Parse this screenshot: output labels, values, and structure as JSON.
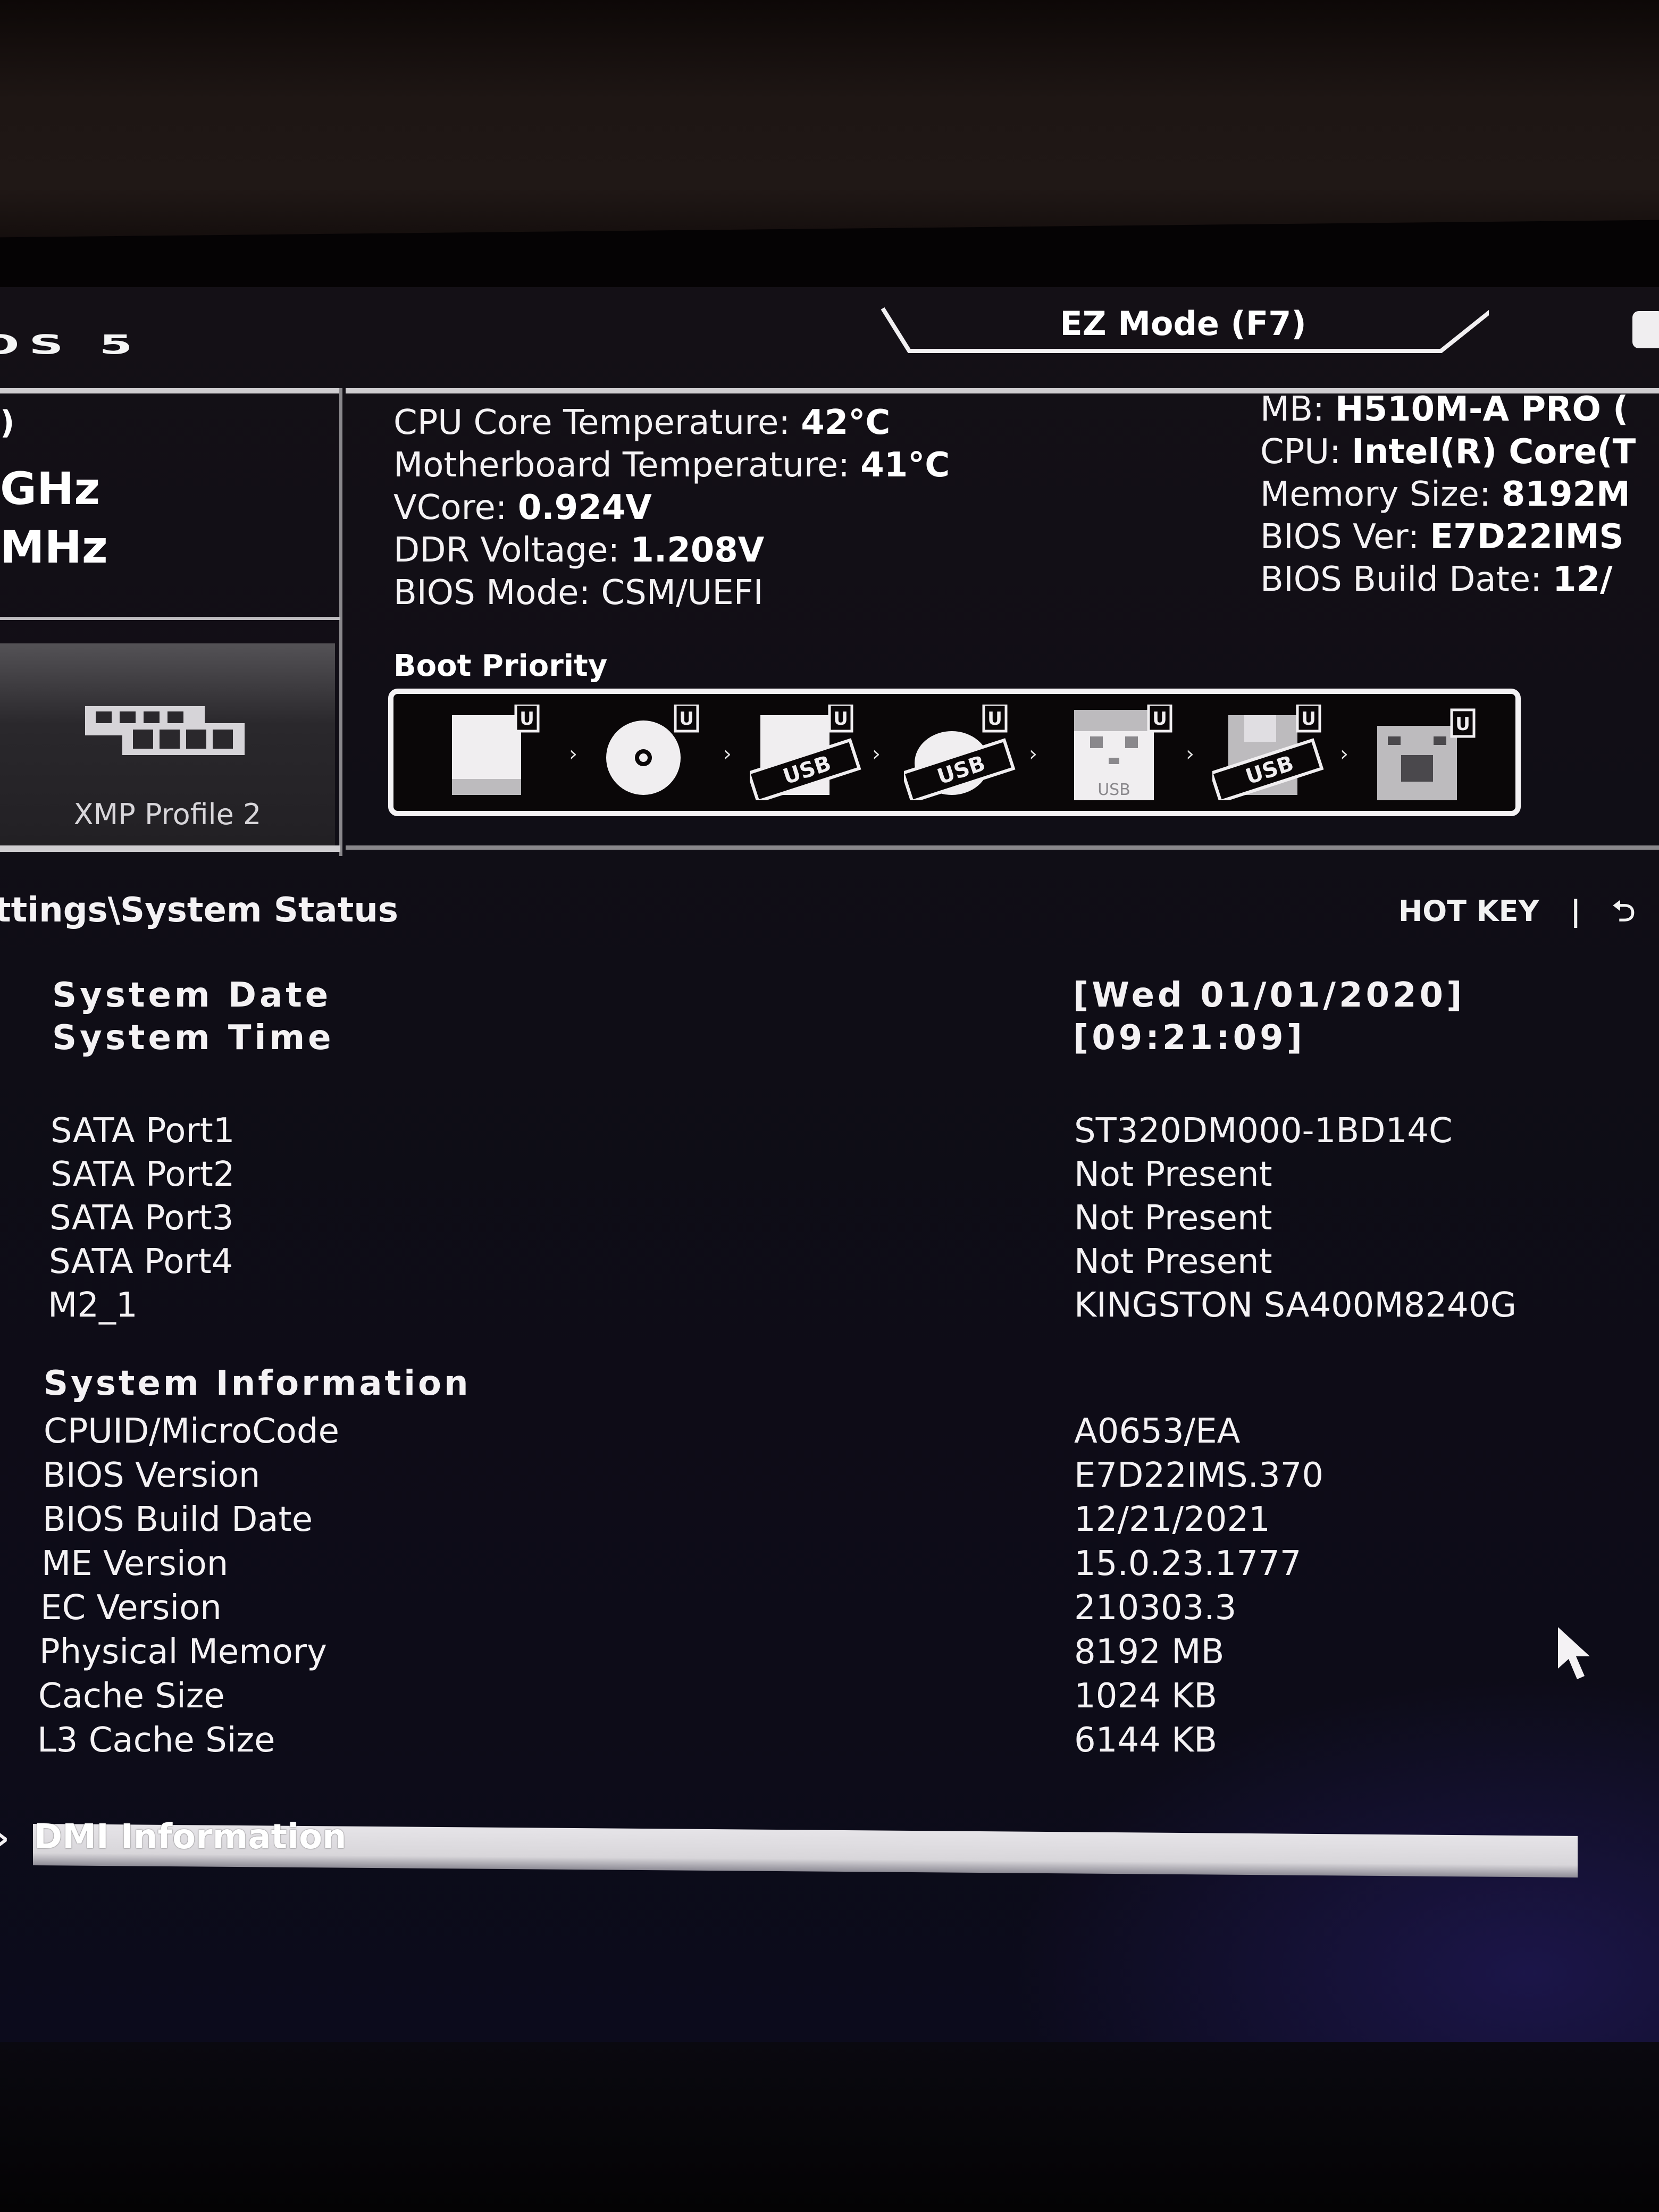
{
  "header": {
    "logo_fragment": "OS 5",
    "ez_mode_label": "EZ Mode (F7)"
  },
  "left_panel": {
    "cpu_speed_unit": "GHz",
    "ddr_speed_unit": "MHz",
    "xmp_label": "XMP Profile 2",
    "xmp_icon": "memory-module-icon"
  },
  "monitor": [
    {
      "label": "CPU Core Temperature:",
      "value": "42°C"
    },
    {
      "label": "Motherboard Temperature:",
      "value": "41°C"
    },
    {
      "label": "VCore:",
      "value": "0.924V"
    },
    {
      "label": "DDR Voltage:",
      "value": "1.208V"
    },
    {
      "label": "BIOS Mode:",
      "value": "CSM/UEFI"
    }
  ],
  "sysinfo": [
    {
      "label": "MB:",
      "value": "H510M-A PRO ("
    },
    {
      "label": "CPU:",
      "value": "Intel(R) Core(T"
    },
    {
      "label": "Memory Size:",
      "value": "8192M"
    },
    {
      "label": "BIOS Ver:",
      "value": "E7D22IMS"
    },
    {
      "label": "BIOS Build Date:",
      "value": "12/"
    }
  ],
  "boot_priority": {
    "title": "Boot Priority",
    "badge": "U",
    "devices": [
      {
        "icon": "hard-drive-icon"
      },
      {
        "icon": "optical-disc-icon"
      },
      {
        "icon": "usb-hard-drive-icon",
        "tag": "USB"
      },
      {
        "icon": "usb-optical-disc-icon",
        "tag": "USB"
      },
      {
        "icon": "usb-key-icon",
        "tag": "USB"
      },
      {
        "icon": "usb-floppy-icon",
        "tag": "USB"
      },
      {
        "icon": "network-icon"
      }
    ]
  },
  "breadcrumb": "ttings\\System Status",
  "hotkey": {
    "label": "HOT KEY",
    "separator": "|",
    "back_icon": "back-arrow-icon"
  },
  "date_time": [
    {
      "label": "System  Date",
      "value": "[Wed  01/01/2020]"
    },
    {
      "label": "System  Time",
      "value": "[09:21:09]"
    }
  ],
  "storage": [
    {
      "label": "SATA Port1",
      "value": "ST320DM000-1BD14C"
    },
    {
      "label": "SATA Port2",
      "value": "Not Present"
    },
    {
      "label": "SATA Port3",
      "value": "Not Present"
    },
    {
      "label": "SATA Port4",
      "value": "Not Present"
    },
    {
      "label": "M2_1",
      "value": "KINGSTON SA400M8240G"
    }
  ],
  "system_information": {
    "title": "System  Information",
    "rows": [
      {
        "label": "CPUID/MicroCode",
        "value": "A0653/EA"
      },
      {
        "label": "BIOS Version",
        "value": "E7D22IMS.370"
      },
      {
        "label": "BIOS Build Date",
        "value": "12/21/2021"
      },
      {
        "label": "ME Version",
        "value": "15.0.23.1777"
      },
      {
        "label": "EC Version",
        "value": "210303.3"
      },
      {
        "label": "Physical Memory",
        "value": "8192 MB"
      },
      {
        "label": "Cache Size",
        "value": "1024 KB"
      },
      {
        "label": "L3 Cache Size",
        "value": "6144 KB"
      }
    ]
  },
  "dmi": {
    "arrow": "›",
    "label": "DMI Information"
  }
}
